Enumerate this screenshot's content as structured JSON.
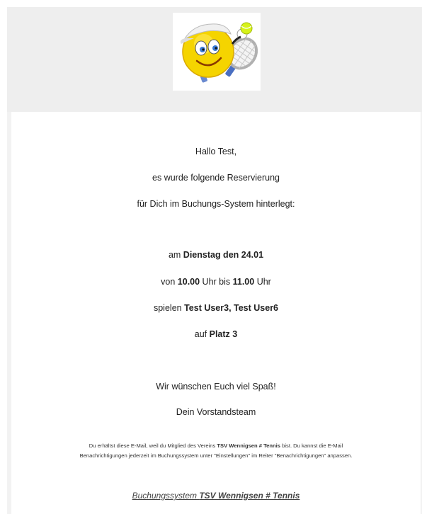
{
  "header": {
    "logo": "tennis-smiley-logo"
  },
  "email": {
    "greeting": "Hallo Test,",
    "intro_line1": "es wurde folgende Reservierung",
    "intro_line2": "für Dich im Buchungs-System hinterlegt:",
    "date_prefix": "am ",
    "date_value": "Dienstag den 24.01",
    "time_prefix": "von ",
    "time_from": "10.00",
    "time_mid": " Uhr bis ",
    "time_to": "11.00",
    "time_suffix": " Uhr",
    "players_prefix": "spielen ",
    "players_value": "Test User3, Test User6",
    "court_prefix": "auf ",
    "court_value": "Platz 3",
    "wish": "Wir wünschen Euch viel Spaß!",
    "signature": "Dein Vorstandsteam"
  },
  "notice": {
    "line1_pre": "Du erhältst diese E-Mail, weil du Mitglied des Vereins ",
    "club": "TSV Wennigsen # Tennis",
    "line1_post": " bist. Du kannst die E-Mail",
    "line2": "Benachrichtigungen jederzeit im Buchungssystem unter \"Einstellungen\" im Reiter \"Benachrichtigungen\" anpassen."
  },
  "footer": {
    "link_prefix": "Buchungssystem ",
    "link_club": "TSV Wennigsen # Tennis"
  }
}
